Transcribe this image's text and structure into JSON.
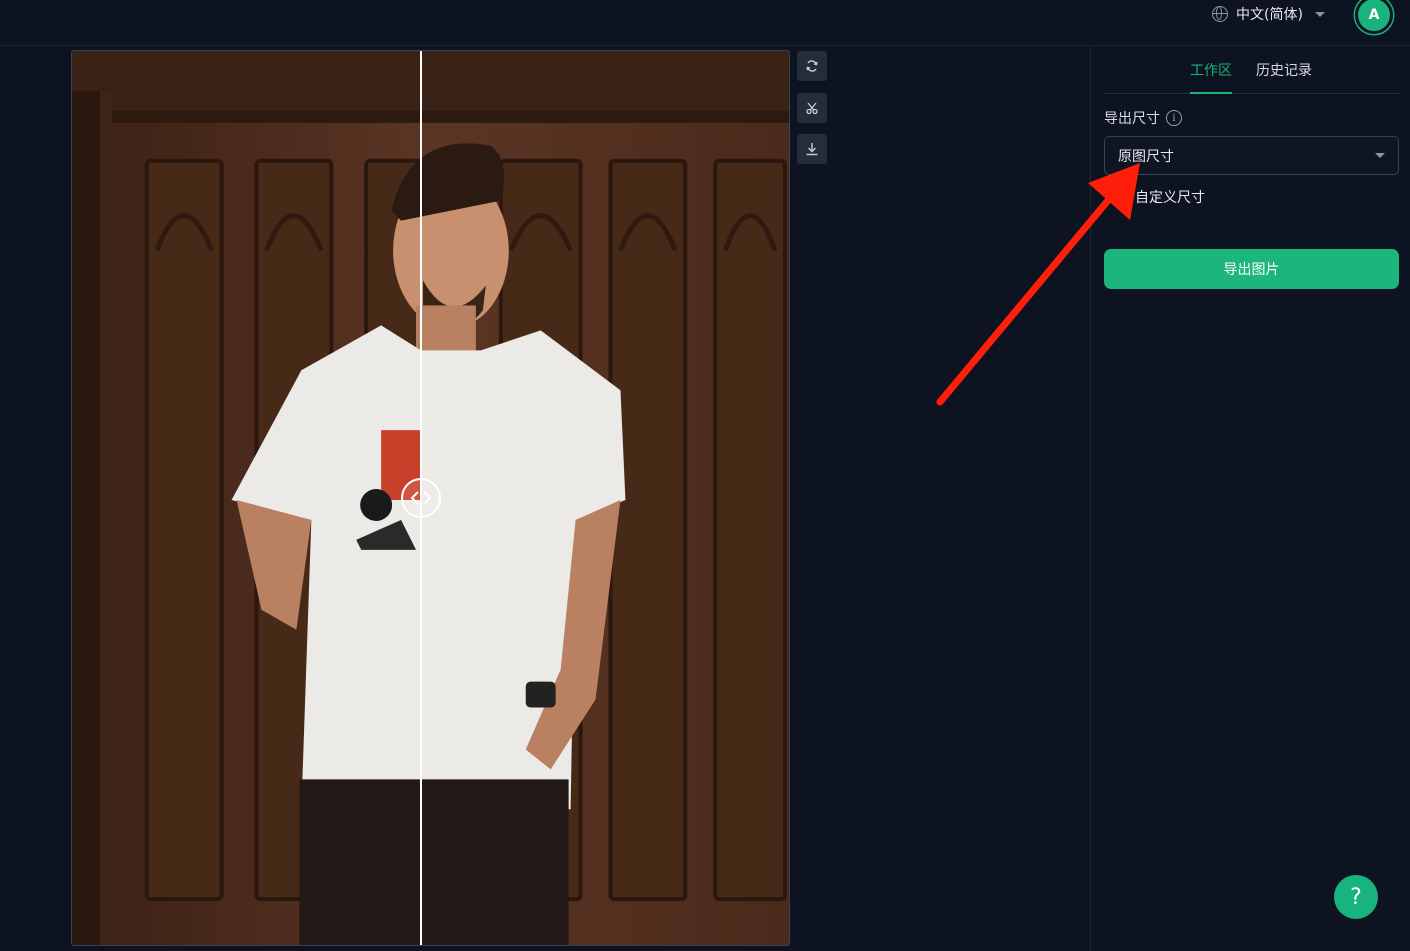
{
  "header": {
    "language_label": "中文(简体)",
    "avatar_initial": "A"
  },
  "toolbar": {
    "tools": [
      {
        "icon": "rotate-icon"
      },
      {
        "icon": "scissors-icon"
      },
      {
        "icon": "download-icon"
      }
    ]
  },
  "side_panel": {
    "tabs": [
      {
        "label": "工作区",
        "active": true
      },
      {
        "label": "历史记录",
        "active": false
      }
    ],
    "export_size_label": "导出尺寸",
    "size_select": {
      "value": "原图尺寸"
    },
    "custom_size_option": "自定义尺寸",
    "export_button": "导出图片"
  },
  "help_button": "?",
  "colors": {
    "accent": "#19b37d",
    "background": "#0d1320",
    "annotation_arrow": "#ff1e0a"
  }
}
